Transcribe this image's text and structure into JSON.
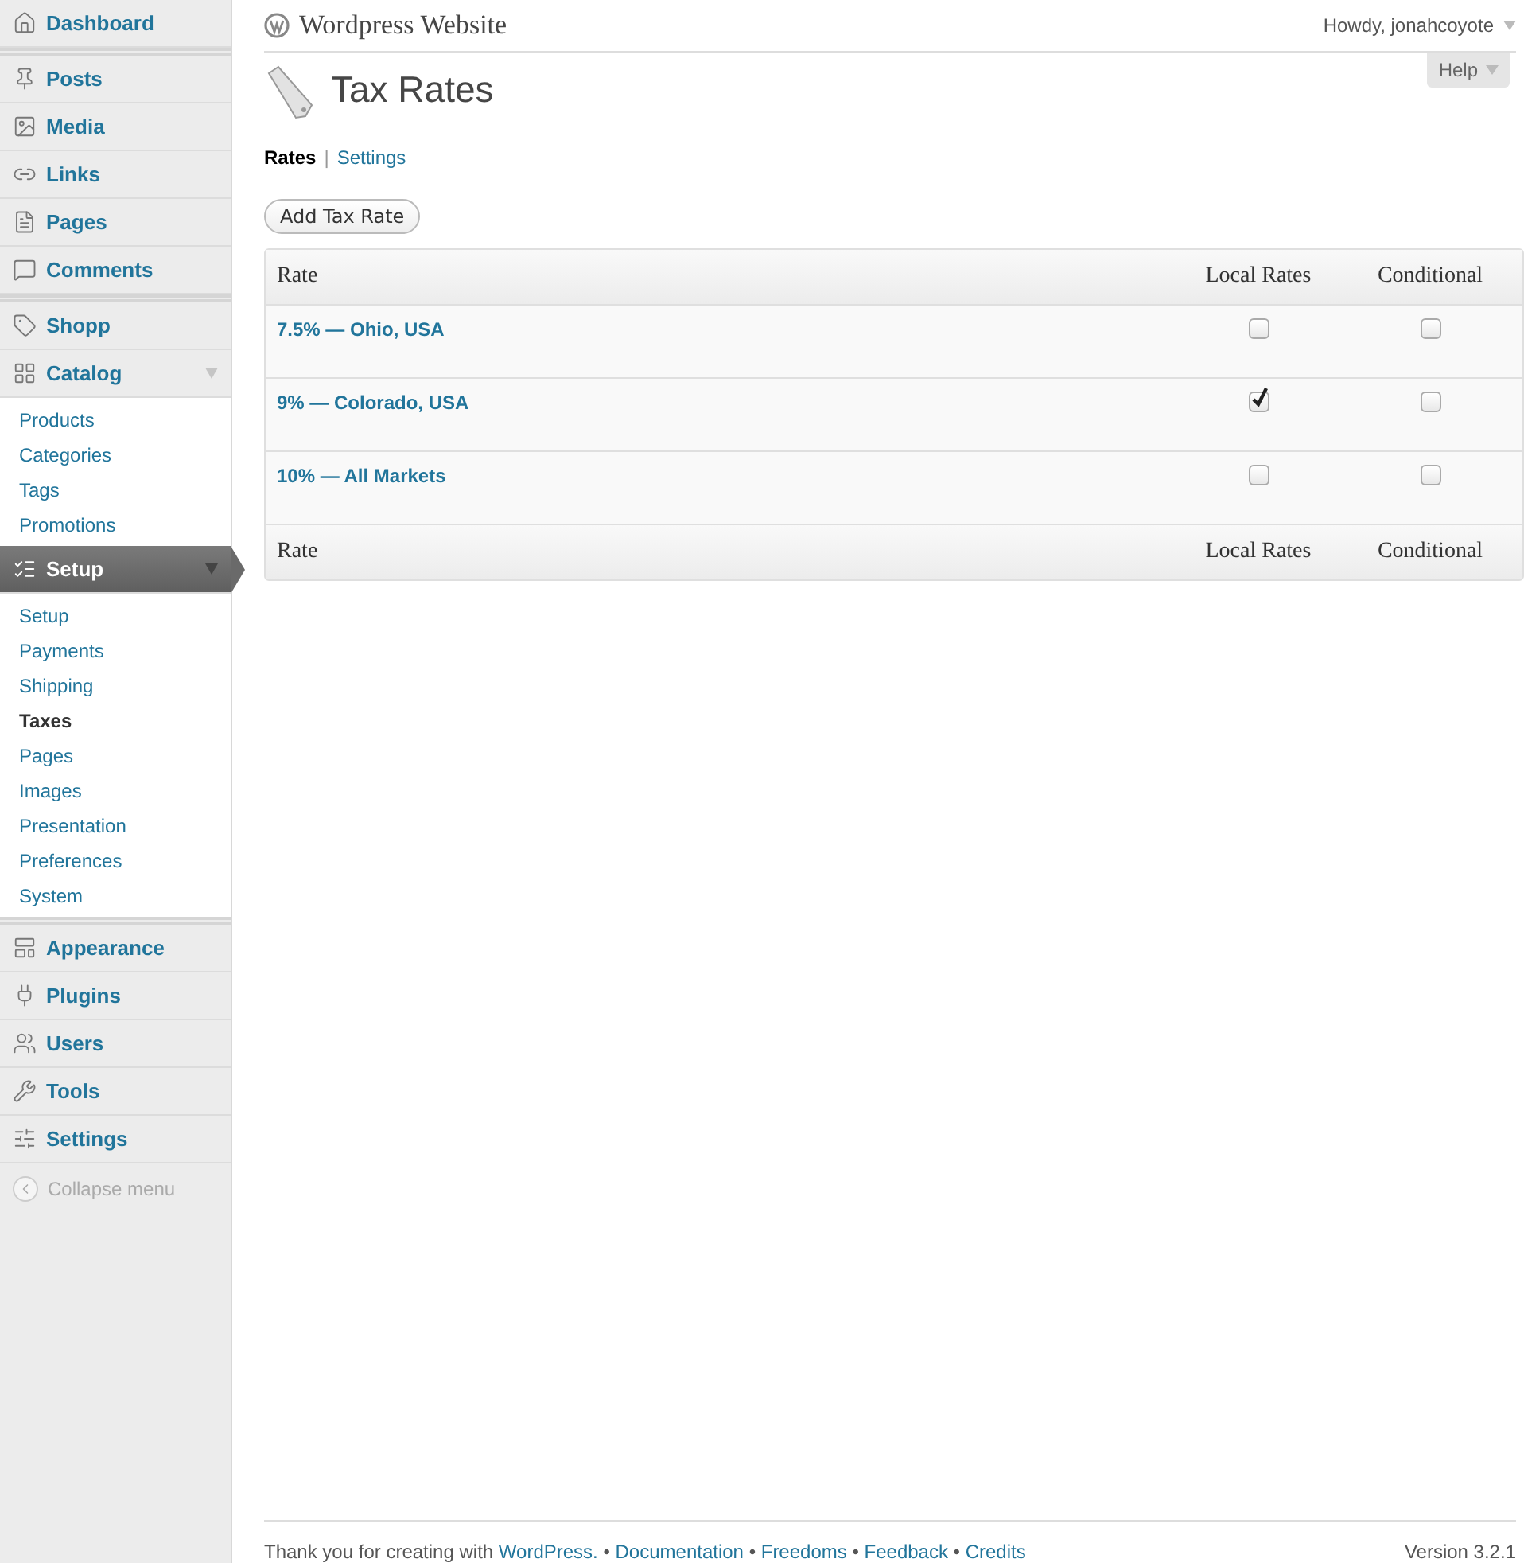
{
  "sidebar": {
    "groups": [
      [
        {
          "label": "Dashboard",
          "selected": false,
          "expanded": false
        }
      ],
      [
        {
          "label": "Posts",
          "selected": false,
          "expanded": false
        },
        {
          "label": "Media",
          "selected": false,
          "expanded": false
        },
        {
          "label": "Links",
          "selected": false,
          "expanded": false
        },
        {
          "label": "Pages",
          "selected": false,
          "expanded": false
        },
        {
          "label": "Comments",
          "selected": false,
          "expanded": false
        }
      ],
      [
        {
          "label": "Shopp",
          "selected": false,
          "expanded": false
        },
        {
          "label": "Catalog",
          "selected": false,
          "expanded": true,
          "children": [
            {
              "label": "Products",
              "selected": false
            },
            {
              "label": "Categories",
              "selected": false
            },
            {
              "label": "Tags",
              "selected": false
            },
            {
              "label": "Promotions",
              "selected": false
            }
          ]
        },
        {
          "label": "Setup",
          "selected": true,
          "expanded": true,
          "children": [
            {
              "label": "Setup",
              "selected": false
            },
            {
              "label": "Payments",
              "selected": false
            },
            {
              "label": "Shipping",
              "selected": false
            },
            {
              "label": "Taxes",
              "selected": true
            },
            {
              "label": "Pages",
              "selected": false
            },
            {
              "label": "Images",
              "selected": false
            },
            {
              "label": "Presentation",
              "selected": false
            },
            {
              "label": "Preferences",
              "selected": false
            },
            {
              "label": "System",
              "selected": false
            }
          ]
        }
      ],
      [
        {
          "label": "Appearance",
          "selected": false,
          "expanded": false
        },
        {
          "label": "Plugins",
          "selected": false,
          "expanded": false
        },
        {
          "label": "Users",
          "selected": false,
          "expanded": false
        },
        {
          "label": "Tools",
          "selected": false,
          "expanded": false
        },
        {
          "label": "Settings",
          "selected": false,
          "expanded": false
        }
      ]
    ],
    "collapse": "Collapse menu"
  },
  "header": {
    "site_title": "Wordpress Website",
    "greeting": "Howdy, jonahcoyote",
    "help": "Help"
  },
  "page": {
    "title": "Tax Rates",
    "views": [
      {
        "label": "Rates",
        "selected": true
      },
      {
        "label": "Settings",
        "selected": false
      }
    ],
    "view_separator": "|",
    "add_button": "Add Tax Rate"
  },
  "table": {
    "columns": [
      "Rate",
      "Local Rates",
      "Conditional"
    ],
    "rows": [
      {
        "rate": "7.5% — Ohio, USA",
        "local_rates": false,
        "conditional": false
      },
      {
        "rate": "9% — Colorado, USA",
        "local_rates": true,
        "conditional": false
      },
      {
        "rate": "10% — All Markets",
        "local_rates": false,
        "conditional": false
      }
    ],
    "footer_columns": [
      "Rate",
      "Local Rates",
      "Conditional"
    ]
  },
  "footer": {
    "lead": "Thank you for creating with",
    "links": [
      "WordPress.",
      "Documentation",
      "Freedoms",
      "Feedback",
      "Credits"
    ],
    "separator": "•",
    "version": "Version 3.2.1"
  }
}
